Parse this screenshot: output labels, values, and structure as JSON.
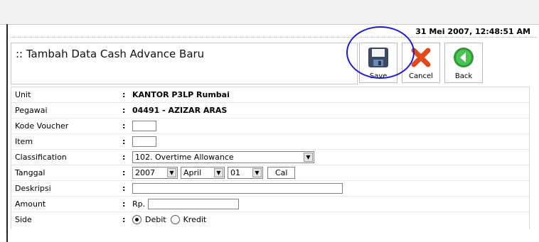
{
  "header": {
    "timestamp": "31 Mei 2007, 12:48:51 AM"
  },
  "page": {
    "title": ":: Tambah Data Cash Advance Baru"
  },
  "toolbar": {
    "save_label": "Save",
    "cancel_label": "Cancel",
    "back_label": "Back"
  },
  "form": {
    "unit": {
      "label": "Unit",
      "value": "KANTOR P3LP Rumbai"
    },
    "pegawai": {
      "label": "Pegawai",
      "value": "04491 - AZIZAR ARAS"
    },
    "kode_voucher": {
      "label": "Kode Voucher",
      "value": ""
    },
    "item": {
      "label": "Item",
      "value": ""
    },
    "classification": {
      "label": "Classification",
      "selected": "102. Overtime Allowance"
    },
    "tanggal": {
      "label": "Tanggal",
      "year": "2007",
      "month": "April",
      "day": "01",
      "cal_label": "Cal"
    },
    "deskripsi": {
      "label": "Deskripsi",
      "value": ""
    },
    "amount": {
      "label": "Amount",
      "prefix": "Rp.",
      "value": ""
    },
    "side": {
      "label": "Side",
      "option_debit": "Debit",
      "option_kredit": "Kredit",
      "selected": "Debit"
    }
  },
  "colors": {
    "accent_callout": "#1a1ad0",
    "cancel_red": "#e04a1a",
    "back_green": "#2f9a35"
  },
  "icons": {
    "save": "floppy-disk-icon",
    "cancel": "red-x-icon",
    "back": "green-back-arrow-icon"
  }
}
